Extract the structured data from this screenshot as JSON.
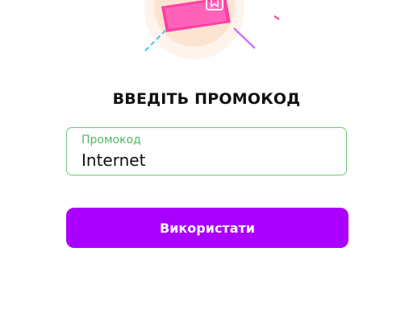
{
  "dialog": {
    "title": "ВВЕДІТЬ ПРОМОКОД",
    "promo_field": {
      "label": "Промокод",
      "value": "Internet"
    },
    "submit_label": "Використати"
  },
  "illustration": {
    "icon": "coupon-ticket-icon",
    "colors": {
      "circle": "#fde7d6",
      "ticket": "#ff3ea5",
      "accent_blue": "#3cc6f2",
      "accent_purple": "#c875ff",
      "accent_pink": "#ff4fa3"
    }
  },
  "colors": {
    "field_border": "#6cc97a",
    "field_label": "#4fb665",
    "button_bg": "#aa00ff",
    "button_text": "#ffffff"
  }
}
